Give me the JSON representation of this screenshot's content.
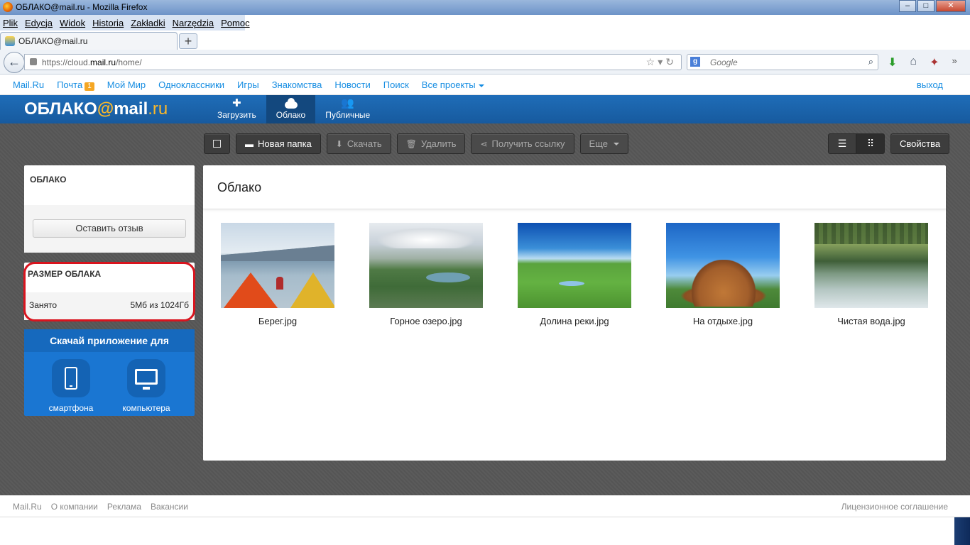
{
  "window": {
    "title": "ОБЛАКО@mail.ru - Mozilla Firefox",
    "controls": {
      "minimize": "–",
      "maximize": "□",
      "close": "✕"
    }
  },
  "menubar": [
    "Plik",
    "Edycja",
    "Widok",
    "Historia",
    "Zakładki",
    "Narzędzia",
    "Pomoc"
  ],
  "tab": {
    "label": "ОБЛАКО@mail.ru",
    "new_tab": "+"
  },
  "navbar": {
    "back": "←",
    "url_prefix": "https://cloud.",
    "url_domain": "mail.ru",
    "url_suffix": "/home/",
    "search_placeholder": "Google",
    "search_engine_letter": "g"
  },
  "portal": {
    "links": [
      "Mail.Ru",
      "Почта",
      "Мой Мир",
      "Одноклассники",
      "Игры",
      "Знакомства",
      "Новости",
      "Поиск",
      "Все проекты"
    ],
    "mail_badge": "1",
    "logout": "выход"
  },
  "header": {
    "logo_main": "ОБЛАКО",
    "logo_at": "@",
    "logo_mail": "mail",
    "logo_ru": ".ru",
    "nav": [
      {
        "label": "Загрузить",
        "icon": "plus-icon"
      },
      {
        "label": "Облако",
        "icon": "cloud-icon"
      },
      {
        "label": "Публичные",
        "icon": "users-icon"
      }
    ]
  },
  "toolbar": {
    "new_folder": "Новая папка",
    "download": "Скачать",
    "delete": "Удалить",
    "get_link": "Получить ссылку",
    "more": "Еще",
    "properties": "Свойства"
  },
  "sidebar": {
    "cloud_title": "ОБЛАКО",
    "feedback_button": "Оставить отзыв",
    "size_title": "РАЗМЕР ОБЛАКА",
    "used_label": "Занято",
    "used_value": "5Мб из 1024Гб",
    "app_title": "Скачай приложение для",
    "app_smartphone": "смартфона",
    "app_computer": "компьютера"
  },
  "content": {
    "title": "Облако",
    "files": [
      {
        "name": "Берег.jpg"
      },
      {
        "name": "Горное озеро.jpg"
      },
      {
        "name": "Долина реки.jpg"
      },
      {
        "name": "На отдыхе.jpg"
      },
      {
        "name": "Чистая вода.jpg"
      }
    ]
  },
  "footer": {
    "links": [
      "Mail.Ru",
      "О компании",
      "Реклама",
      "Вакансии"
    ],
    "license": "Лицензионное соглашение"
  },
  "colors": {
    "header_blue": "#1f6db8",
    "link_blue": "#168de2",
    "accent_orange": "#fbb829",
    "highlight_red": "#d9141e"
  }
}
